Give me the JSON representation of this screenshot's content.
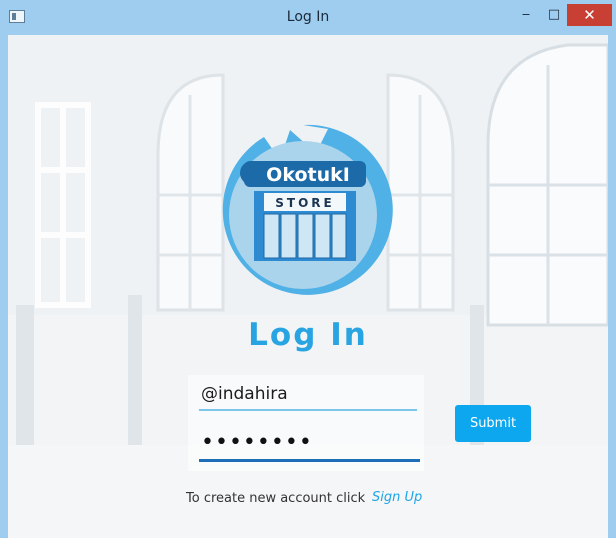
{
  "window": {
    "title": "Log In",
    "minimize_glyph": "‒",
    "maximize_glyph": "□",
    "close_glyph": "✕"
  },
  "logo": {
    "brand": "OkotukI",
    "sub": "STORE"
  },
  "login": {
    "heading": "Log  In",
    "username_value": "@indahira",
    "password_value": "••••••••",
    "submit_label": "Submit"
  },
  "signup": {
    "prompt": "To create new account click",
    "link": "Sign Up"
  },
  "colors": {
    "accent": "#29a4e2",
    "button": "#0ca7ef",
    "titlebar": "#9fcdf0",
    "close": "#c84033"
  },
  "icons": {
    "app": "app-window-icon",
    "minimize": "minimize-icon",
    "maximize": "maximize-icon",
    "close": "close-icon"
  }
}
